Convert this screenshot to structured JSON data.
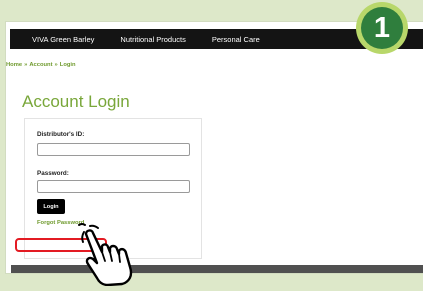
{
  "nav": {
    "items": [
      "VIVA Green Barley",
      "Nutritional Products",
      "Personal Care"
    ]
  },
  "breadcrumb": {
    "items": [
      "Home",
      "Account",
      "Login"
    ],
    "separator": "»"
  },
  "page": {
    "title": "Account Login"
  },
  "login_form": {
    "distributor_label": "Distributor's ID:",
    "distributor_value": "",
    "password_label": "Password:",
    "password_value": "",
    "login_button": "Login",
    "forgot_password": "Forgot Password"
  },
  "step_badge": {
    "number": "1"
  },
  "colors": {
    "page_background": "#dde8c9",
    "navbar": "#141414",
    "accent_green": "#79a73a",
    "highlight_red": "#e31b23",
    "badge_outer": "#b8d76a",
    "badge_inner": "#2f7e3d"
  },
  "icons": {
    "pointer": "hand-pointer-icon"
  }
}
